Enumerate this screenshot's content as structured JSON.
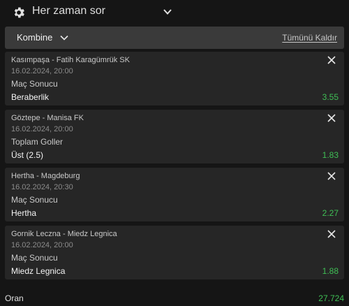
{
  "topbar": {
    "settings_icon": "gear-icon",
    "title": "Her zaman sor",
    "dropdown_icon": "chevron-down-icon"
  },
  "betslip": {
    "type_label": "Kombine",
    "type_icon": "chevron-down-icon",
    "clear_all_label": "Tümünü Kaldır"
  },
  "selections": [
    {
      "match": "Kasımpaşa - Fatih Karagümrük SK",
      "date": "16.02.2024, 20:00",
      "market": "Maç Sonucu",
      "pick": "Beraberlik",
      "odds": "3.55"
    },
    {
      "match": "Göztepe - Manisa FK",
      "date": "16.02.2024, 20:00",
      "market": "Toplam Goller",
      "pick": "Üst (2.5)",
      "odds": "1.83"
    },
    {
      "match": "Hertha - Magdeburg",
      "date": "16.02.2024, 20:30",
      "market": "Maç Sonucu",
      "pick": "Hertha",
      "odds": "2.27"
    },
    {
      "match": "Gornik Leczna - Miedz Legnica",
      "date": "16.02.2024, 20:00",
      "market": "Maç Sonucu",
      "pick": "Miedz Legnica",
      "odds": "1.88"
    }
  ],
  "total": {
    "label": "Oran",
    "value": "27.724"
  },
  "colors": {
    "background": "#151515",
    "card": "#262626",
    "header": "#3a3a3a",
    "odds": "#3fbf55"
  }
}
